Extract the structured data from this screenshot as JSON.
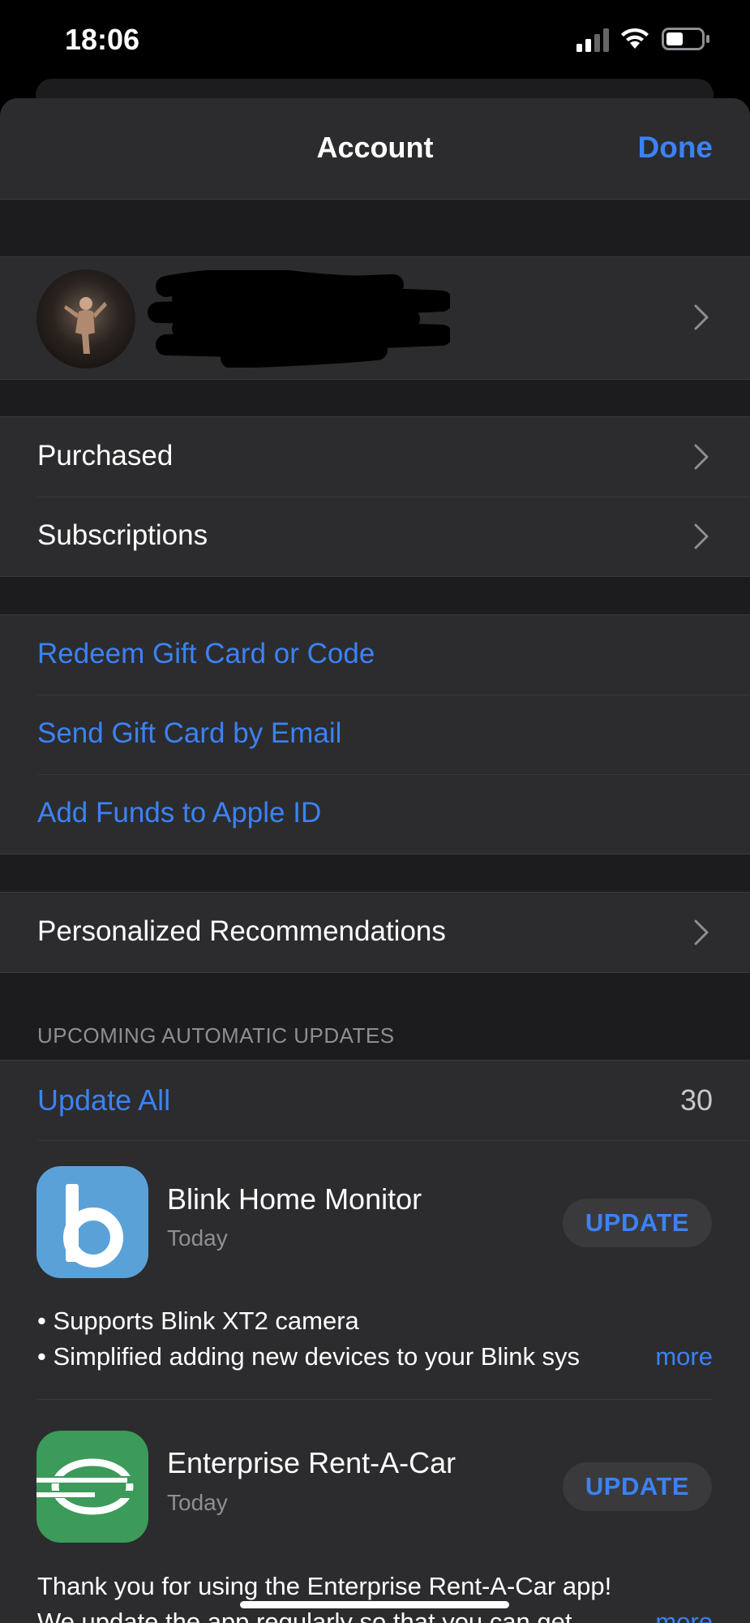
{
  "status_bar": {
    "time": "18:06"
  },
  "nav": {
    "title": "Account",
    "done_label": "Done"
  },
  "profile": {
    "name_redacted": true
  },
  "account_items": [
    {
      "label": "Purchased"
    },
    {
      "label": "Subscriptions"
    }
  ],
  "gift_items": [
    {
      "label": "Redeem Gift Card or Code"
    },
    {
      "label": "Send Gift Card by Email"
    },
    {
      "label": "Add Funds to Apple ID"
    }
  ],
  "recommendations": {
    "label": "Personalized Recommendations"
  },
  "updates_section": {
    "header": "UPCOMING AUTOMATIC UPDATES",
    "update_all_label": "Update All",
    "count": "30",
    "apps": [
      {
        "name": "Blink Home Monitor",
        "date": "Today",
        "button": "UPDATE",
        "icon": "blink-b-icon",
        "notes": [
          "• Supports Blink XT2 camera",
          "• Simplified adding new devices to your Blink sys"
        ],
        "more": "more"
      },
      {
        "name": "Enterprise Rent-A-Car",
        "date": "Today",
        "button": "UPDATE",
        "icon": "enterprise-e-icon",
        "notes": [
          "Thank you for using the Enterprise Rent-A-Car app!",
          "We update the app regularly so that you can get"
        ],
        "more": "more"
      }
    ]
  },
  "colors": {
    "accent": "#3b82f6",
    "background": "#1c1c1e",
    "cell": "#2c2c2e",
    "blink": "#5aa1d8",
    "enterprise": "#3c9a5a"
  }
}
